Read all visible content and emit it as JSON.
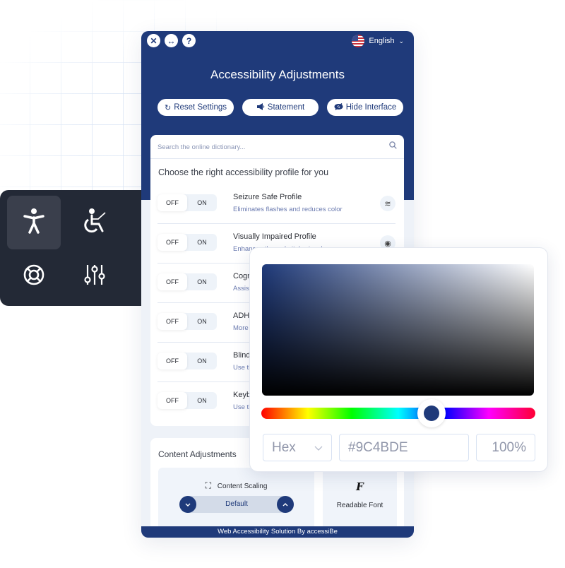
{
  "widget": {
    "top_icons": [
      {
        "name": "close-icon",
        "glyph": "✕"
      },
      {
        "name": "resize-icon",
        "glyph": "↔"
      },
      {
        "name": "help-icon",
        "glyph": "?"
      }
    ],
    "language": {
      "label": "English",
      "flag": "us-flag-icon"
    },
    "title": "Accessibility Adjustments",
    "header_buttons": {
      "reset": {
        "label": "Reset Settings",
        "icon": "↻"
      },
      "statement": {
        "label": "Statement",
        "icon": "📢"
      },
      "hide": {
        "label": "Hide Interface",
        "icon": "👁"
      }
    },
    "search": {
      "placeholder": "Search the online dictionary...",
      "icon": "⌕"
    },
    "profiles_heading": "Choose the right accessibility profile for you",
    "toggle": {
      "off": "OFF",
      "on": "ON"
    },
    "profiles": [
      {
        "name": "Seizure Safe Profile",
        "desc": "Eliminates flashes and reduces color",
        "icon": "≋"
      },
      {
        "name": "Visually Impaired Profile",
        "desc": "Enhances the website's visuals",
        "icon": "◉"
      },
      {
        "name": "Cognitive Disability Profile",
        "desc": "Assists with reading and focusing",
        "icon": ""
      },
      {
        "name": "ADHD Friendly Profile",
        "desc": "More focus and fewer distractions",
        "icon": ""
      },
      {
        "name": "Blindness Mode",
        "desc": "Use the website with your screen-reader",
        "icon": ""
      },
      {
        "name": "Keyboard Navigation (Motor)",
        "desc": "Use the website with the keyboard",
        "icon": ""
      }
    ],
    "content_adjustments": {
      "title": "Content Adjustments",
      "scaling": {
        "label": "Content Scaling",
        "value": "Default"
      },
      "readable_font": {
        "label": "Readable Font",
        "icon": "F"
      }
    },
    "footer": "Web Accessibility Solution By accessiBe"
  },
  "dark_panel": {
    "items": [
      {
        "name": "accessibility-person-icon",
        "active": true
      },
      {
        "name": "wheelchair-icon",
        "active": false
      },
      {
        "name": "lifebuoy-icon",
        "active": false
      },
      {
        "name": "sliders-icon",
        "active": false
      }
    ]
  },
  "color_picker": {
    "base_color": "#1f3a7a",
    "hue_position": 0.62,
    "mode": "Hex",
    "hex_value": "#9C4BDE",
    "alpha": "100%"
  }
}
